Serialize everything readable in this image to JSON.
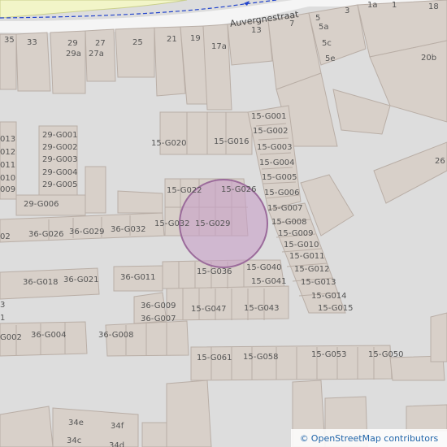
{
  "colors": {
    "ground": "#dddddd",
    "building": "#d8d0c9",
    "building_edge": "#b9aea6",
    "road": "#f5f5f5",
    "water_green": "#f2f5c8",
    "circle_fill": "#c8a0c8",
    "circle_stroke": "#9b6b9b"
  },
  "street_name": "Auvergnestraat",
  "attribution": {
    "symbol": "©",
    "text": "OpenStreetMap contributors"
  },
  "labels": [
    "35",
    "33",
    "29",
    "29a",
    "27",
    "27a",
    "25",
    "21",
    "19",
    "17a",
    "13",
    "7",
    "5",
    "5a",
    "5c",
    "5e",
    "3",
    "1a",
    "1",
    "18",
    "20b",
    "26",
    "29-G001",
    "29-G002",
    "29-G003",
    "29-G004",
    "29-G005",
    "29-G006",
    "013",
    "012",
    "011",
    "010",
    "009",
    "15-G001",
    "15-G002",
    "15-G003",
    "15-G004",
    "15-G005",
    "15-G006",
    "15-G007",
    "15-G008",
    "15-G009",
    "15-G010",
    "15-G011",
    "15-G012",
    "15-G013",
    "15-G014",
    "15-G015",
    "15-G016",
    "15-G020",
    "15-G022",
    "15-G026",
    "15-G029",
    "15-G032",
    "15-G036",
    "15-G040",
    "15-G041",
    "15-G043",
    "15-G047",
    "15-G050",
    "15-G053",
    "15-G058",
    "15-G061",
    "36-G026",
    "36-G029",
    "36-G032",
    "36-G018",
    "36-G021",
    "36-G011",
    "36-G009",
    "36-G007",
    "36-G004",
    "36-G008",
    "G002",
    "02",
    "3",
    "1",
    "34e",
    "34f",
    "34c",
    "34d"
  ]
}
